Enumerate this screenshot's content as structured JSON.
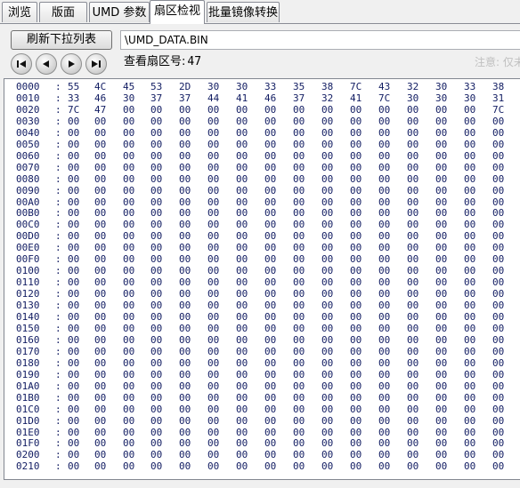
{
  "tabs": [
    {
      "label": "浏览",
      "active": false
    },
    {
      "label": "版面",
      "active": false
    },
    {
      "label": "UMD 参数",
      "active": false
    },
    {
      "label": "扇区检视",
      "active": true
    },
    {
      "label": "批量镜像转换",
      "active": false
    }
  ],
  "toolbar": {
    "refresh_label": "刷新下拉列表",
    "path_value": "\\UMD_DATA.BIN",
    "sector_label": "查看扇区号:",
    "sector_value": "47",
    "note_text": "注意: 仅未"
  },
  "nav_icons": [
    "first-icon",
    "prev-icon",
    "next-icon",
    "last-icon"
  ],
  "colors": {
    "hex_text": "#111c62",
    "window_bg": "#f0f0f0",
    "panel_bg": "#ffffff"
  },
  "hex_rows": [
    {
      "offset": "0000",
      "bytes": [
        "55",
        "4C",
        "45",
        "53",
        "2D",
        "30",
        "30",
        "33",
        "35",
        "38",
        "7C",
        "43",
        "32",
        "30",
        "33",
        "38"
      ]
    },
    {
      "offset": "0010",
      "bytes": [
        "33",
        "46",
        "30",
        "37",
        "37",
        "44",
        "41",
        "46",
        "37",
        "32",
        "41",
        "7C",
        "30",
        "30",
        "30",
        "31"
      ]
    },
    {
      "offset": "0020",
      "bytes": [
        "7C",
        "47",
        "00",
        "00",
        "00",
        "00",
        "00",
        "00",
        "00",
        "00",
        "00",
        "00",
        "00",
        "00",
        "00",
        "7C"
      ]
    },
    {
      "offset": "0030",
      "bytes": [
        "00",
        "00",
        "00",
        "00",
        "00",
        "00",
        "00",
        "00",
        "00",
        "00",
        "00",
        "00",
        "00",
        "00",
        "00",
        "00"
      ]
    },
    {
      "offset": "0040",
      "bytes": [
        "00",
        "00",
        "00",
        "00",
        "00",
        "00",
        "00",
        "00",
        "00",
        "00",
        "00",
        "00",
        "00",
        "00",
        "00",
        "00"
      ]
    },
    {
      "offset": "0050",
      "bytes": [
        "00",
        "00",
        "00",
        "00",
        "00",
        "00",
        "00",
        "00",
        "00",
        "00",
        "00",
        "00",
        "00",
        "00",
        "00",
        "00"
      ]
    },
    {
      "offset": "0060",
      "bytes": [
        "00",
        "00",
        "00",
        "00",
        "00",
        "00",
        "00",
        "00",
        "00",
        "00",
        "00",
        "00",
        "00",
        "00",
        "00",
        "00"
      ]
    },
    {
      "offset": "0070",
      "bytes": [
        "00",
        "00",
        "00",
        "00",
        "00",
        "00",
        "00",
        "00",
        "00",
        "00",
        "00",
        "00",
        "00",
        "00",
        "00",
        "00"
      ]
    },
    {
      "offset": "0080",
      "bytes": [
        "00",
        "00",
        "00",
        "00",
        "00",
        "00",
        "00",
        "00",
        "00",
        "00",
        "00",
        "00",
        "00",
        "00",
        "00",
        "00"
      ]
    },
    {
      "offset": "0090",
      "bytes": [
        "00",
        "00",
        "00",
        "00",
        "00",
        "00",
        "00",
        "00",
        "00",
        "00",
        "00",
        "00",
        "00",
        "00",
        "00",
        "00"
      ]
    },
    {
      "offset": "00A0",
      "bytes": [
        "00",
        "00",
        "00",
        "00",
        "00",
        "00",
        "00",
        "00",
        "00",
        "00",
        "00",
        "00",
        "00",
        "00",
        "00",
        "00"
      ]
    },
    {
      "offset": "00B0",
      "bytes": [
        "00",
        "00",
        "00",
        "00",
        "00",
        "00",
        "00",
        "00",
        "00",
        "00",
        "00",
        "00",
        "00",
        "00",
        "00",
        "00"
      ]
    },
    {
      "offset": "00C0",
      "bytes": [
        "00",
        "00",
        "00",
        "00",
        "00",
        "00",
        "00",
        "00",
        "00",
        "00",
        "00",
        "00",
        "00",
        "00",
        "00",
        "00"
      ]
    },
    {
      "offset": "00D0",
      "bytes": [
        "00",
        "00",
        "00",
        "00",
        "00",
        "00",
        "00",
        "00",
        "00",
        "00",
        "00",
        "00",
        "00",
        "00",
        "00",
        "00"
      ]
    },
    {
      "offset": "00E0",
      "bytes": [
        "00",
        "00",
        "00",
        "00",
        "00",
        "00",
        "00",
        "00",
        "00",
        "00",
        "00",
        "00",
        "00",
        "00",
        "00",
        "00"
      ]
    },
    {
      "offset": "00F0",
      "bytes": [
        "00",
        "00",
        "00",
        "00",
        "00",
        "00",
        "00",
        "00",
        "00",
        "00",
        "00",
        "00",
        "00",
        "00",
        "00",
        "00"
      ]
    },
    {
      "offset": "0100",
      "bytes": [
        "00",
        "00",
        "00",
        "00",
        "00",
        "00",
        "00",
        "00",
        "00",
        "00",
        "00",
        "00",
        "00",
        "00",
        "00",
        "00"
      ]
    },
    {
      "offset": "0110",
      "bytes": [
        "00",
        "00",
        "00",
        "00",
        "00",
        "00",
        "00",
        "00",
        "00",
        "00",
        "00",
        "00",
        "00",
        "00",
        "00",
        "00"
      ]
    },
    {
      "offset": "0120",
      "bytes": [
        "00",
        "00",
        "00",
        "00",
        "00",
        "00",
        "00",
        "00",
        "00",
        "00",
        "00",
        "00",
        "00",
        "00",
        "00",
        "00"
      ]
    },
    {
      "offset": "0130",
      "bytes": [
        "00",
        "00",
        "00",
        "00",
        "00",
        "00",
        "00",
        "00",
        "00",
        "00",
        "00",
        "00",
        "00",
        "00",
        "00",
        "00"
      ]
    },
    {
      "offset": "0140",
      "bytes": [
        "00",
        "00",
        "00",
        "00",
        "00",
        "00",
        "00",
        "00",
        "00",
        "00",
        "00",
        "00",
        "00",
        "00",
        "00",
        "00"
      ]
    },
    {
      "offset": "0150",
      "bytes": [
        "00",
        "00",
        "00",
        "00",
        "00",
        "00",
        "00",
        "00",
        "00",
        "00",
        "00",
        "00",
        "00",
        "00",
        "00",
        "00"
      ]
    },
    {
      "offset": "0160",
      "bytes": [
        "00",
        "00",
        "00",
        "00",
        "00",
        "00",
        "00",
        "00",
        "00",
        "00",
        "00",
        "00",
        "00",
        "00",
        "00",
        "00"
      ]
    },
    {
      "offset": "0170",
      "bytes": [
        "00",
        "00",
        "00",
        "00",
        "00",
        "00",
        "00",
        "00",
        "00",
        "00",
        "00",
        "00",
        "00",
        "00",
        "00",
        "00"
      ]
    },
    {
      "offset": "0180",
      "bytes": [
        "00",
        "00",
        "00",
        "00",
        "00",
        "00",
        "00",
        "00",
        "00",
        "00",
        "00",
        "00",
        "00",
        "00",
        "00",
        "00"
      ]
    },
    {
      "offset": "0190",
      "bytes": [
        "00",
        "00",
        "00",
        "00",
        "00",
        "00",
        "00",
        "00",
        "00",
        "00",
        "00",
        "00",
        "00",
        "00",
        "00",
        "00"
      ]
    },
    {
      "offset": "01A0",
      "bytes": [
        "00",
        "00",
        "00",
        "00",
        "00",
        "00",
        "00",
        "00",
        "00",
        "00",
        "00",
        "00",
        "00",
        "00",
        "00",
        "00"
      ]
    },
    {
      "offset": "01B0",
      "bytes": [
        "00",
        "00",
        "00",
        "00",
        "00",
        "00",
        "00",
        "00",
        "00",
        "00",
        "00",
        "00",
        "00",
        "00",
        "00",
        "00"
      ]
    },
    {
      "offset": "01C0",
      "bytes": [
        "00",
        "00",
        "00",
        "00",
        "00",
        "00",
        "00",
        "00",
        "00",
        "00",
        "00",
        "00",
        "00",
        "00",
        "00",
        "00"
      ]
    },
    {
      "offset": "01D0",
      "bytes": [
        "00",
        "00",
        "00",
        "00",
        "00",
        "00",
        "00",
        "00",
        "00",
        "00",
        "00",
        "00",
        "00",
        "00",
        "00",
        "00"
      ]
    },
    {
      "offset": "01E0",
      "bytes": [
        "00",
        "00",
        "00",
        "00",
        "00",
        "00",
        "00",
        "00",
        "00",
        "00",
        "00",
        "00",
        "00",
        "00",
        "00",
        "00"
      ]
    },
    {
      "offset": "01F0",
      "bytes": [
        "00",
        "00",
        "00",
        "00",
        "00",
        "00",
        "00",
        "00",
        "00",
        "00",
        "00",
        "00",
        "00",
        "00",
        "00",
        "00"
      ]
    },
    {
      "offset": "0200",
      "bytes": [
        "00",
        "00",
        "00",
        "00",
        "00",
        "00",
        "00",
        "00",
        "00",
        "00",
        "00",
        "00",
        "00",
        "00",
        "00",
        "00"
      ]
    },
    {
      "offset": "0210",
      "bytes": [
        "00",
        "00",
        "00",
        "00",
        "00",
        "00",
        "00",
        "00",
        "00",
        "00",
        "00",
        "00",
        "00",
        "00",
        "00",
        "00"
      ]
    }
  ]
}
